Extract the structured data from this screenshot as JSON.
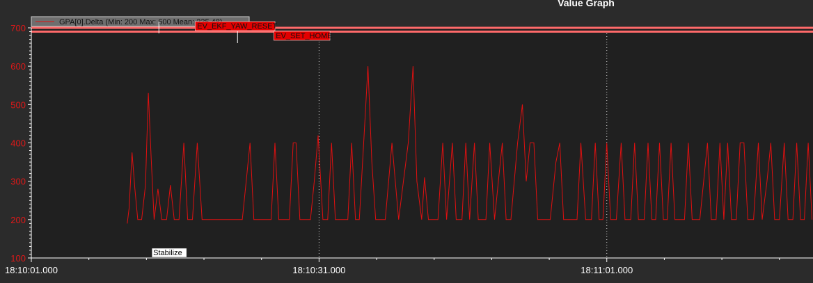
{
  "chart_data": {
    "type": "line",
    "title": "Value Graph",
    "ylim": [
      100,
      700
    ],
    "y_ticks": [
      "100",
      "200",
      "300",
      "400",
      "500",
      "600",
      "700"
    ],
    "x_ticks": [
      "18:10:01.000",
      "18:10:31.000",
      "18:11:01.000"
    ],
    "x_range_seconds": [
      0,
      81.5
    ],
    "x_grid": "vertical dotted at major x ticks",
    "legend_placement": "top-left",
    "series": [
      {
        "name": "GPA[0].Delta",
        "legend_label": "GPA[0].Delta  (Min: 200 Max: 600 Mean: 235.48)",
        "color": "#e01010",
        "points": [
          [
            10.0,
            190
          ],
          [
            10.2,
            230
          ],
          [
            10.5,
            375
          ],
          [
            10.8,
            280
          ],
          [
            11.1,
            200
          ],
          [
            11.5,
            200
          ],
          [
            11.9,
            290
          ],
          [
            12.2,
            530
          ],
          [
            12.5,
            360
          ],
          [
            12.8,
            200
          ],
          [
            13.2,
            280
          ],
          [
            13.6,
            200
          ],
          [
            14.1,
            200
          ],
          [
            14.5,
            290
          ],
          [
            14.9,
            200
          ],
          [
            15.4,
            200
          ],
          [
            15.9,
            400
          ],
          [
            16.3,
            200
          ],
          [
            16.8,
            200
          ],
          [
            17.3,
            400
          ],
          [
            17.8,
            200
          ],
          [
            18.3,
            200
          ],
          [
            19.2,
            200
          ],
          [
            20.1,
            200
          ],
          [
            21.0,
            200
          ],
          [
            22.0,
            200
          ],
          [
            22.4,
            300
          ],
          [
            22.8,
            400
          ],
          [
            23.2,
            200
          ],
          [
            24.2,
            200
          ],
          [
            25.0,
            200
          ],
          [
            25.4,
            400
          ],
          [
            25.8,
            200
          ],
          [
            26.9,
            200
          ],
          [
            27.3,
            400
          ],
          [
            27.6,
            400
          ],
          [
            28.0,
            200
          ],
          [
            29.1,
            200
          ],
          [
            29.5,
            300
          ],
          [
            29.9,
            420
          ],
          [
            30.4,
            200
          ],
          [
            30.9,
            200
          ],
          [
            31.3,
            400
          ],
          [
            31.7,
            200
          ],
          [
            33.0,
            200
          ],
          [
            33.4,
            400
          ],
          [
            33.8,
            200
          ],
          [
            34.2,
            200
          ],
          [
            34.7,
            420
          ],
          [
            35.1,
            600
          ],
          [
            35.5,
            350
          ],
          [
            35.9,
            200
          ],
          [
            36.9,
            200
          ],
          [
            37.6,
            400
          ],
          [
            38.3,
            200
          ],
          [
            39.3,
            400
          ],
          [
            39.8,
            600
          ],
          [
            40.2,
            300
          ],
          [
            40.7,
            200
          ],
          [
            41.0,
            310
          ],
          [
            41.4,
            200
          ],
          [
            42.4,
            200
          ],
          [
            42.9,
            400
          ],
          [
            43.3,
            200
          ],
          [
            43.9,
            400
          ],
          [
            44.3,
            200
          ],
          [
            44.9,
            200
          ],
          [
            45.3,
            400
          ],
          [
            45.7,
            200
          ],
          [
            46.2,
            400
          ],
          [
            46.6,
            200
          ],
          [
            47.4,
            200
          ],
          [
            47.8,
            400
          ],
          [
            48.3,
            200
          ],
          [
            48.7,
            300
          ],
          [
            49.1,
            400
          ],
          [
            49.5,
            200
          ],
          [
            50.0,
            200
          ],
          [
            50.7,
            400
          ],
          [
            51.2,
            500
          ],
          [
            51.6,
            300
          ],
          [
            52.0,
            400
          ],
          [
            52.4,
            400
          ],
          [
            52.8,
            200
          ],
          [
            53.1,
            200
          ],
          [
            54.1,
            200
          ],
          [
            54.7,
            350
          ],
          [
            55.1,
            400
          ],
          [
            55.5,
            200
          ],
          [
            56.9,
            200
          ],
          [
            57.3,
            400
          ],
          [
            57.8,
            200
          ],
          [
            58.4,
            200
          ],
          [
            58.8,
            400
          ],
          [
            59.2,
            200
          ],
          [
            59.6,
            200
          ],
          [
            60.0,
            400
          ],
          [
            60.4,
            200
          ],
          [
            61.0,
            200
          ],
          [
            61.5,
            400
          ],
          [
            61.9,
            200
          ],
          [
            62.5,
            200
          ],
          [
            62.9,
            400
          ],
          [
            63.3,
            200
          ],
          [
            63.9,
            200
          ],
          [
            64.3,
            400
          ],
          [
            64.7,
            200
          ],
          [
            65.1,
            200
          ],
          [
            65.5,
            400
          ],
          [
            65.9,
            200
          ],
          [
            66.3,
            200
          ],
          [
            66.7,
            400
          ],
          [
            67.1,
            200
          ],
          [
            68.1,
            200
          ],
          [
            68.5,
            400
          ],
          [
            68.9,
            200
          ],
          [
            69.7,
            200
          ],
          [
            70.1,
            300
          ],
          [
            70.5,
            400
          ],
          [
            70.9,
            200
          ],
          [
            71.4,
            200
          ],
          [
            71.8,
            400
          ],
          [
            72.2,
            200
          ],
          [
            72.6,
            400
          ],
          [
            73.0,
            200
          ],
          [
            73.5,
            200
          ],
          [
            73.9,
            400
          ],
          [
            74.3,
            400
          ],
          [
            74.7,
            200
          ],
          [
            75.3,
            200
          ],
          [
            75.8,
            400
          ],
          [
            76.2,
            200
          ],
          [
            76.7,
            300
          ],
          [
            77.1,
            400
          ],
          [
            77.5,
            200
          ],
          [
            78.0,
            200
          ],
          [
            78.5,
            400
          ],
          [
            78.9,
            200
          ],
          [
            79.4,
            200
          ],
          [
            79.8,
            400
          ],
          [
            80.2,
            200
          ],
          [
            80.6,
            200
          ],
          [
            81.0,
            400
          ],
          [
            81.4,
            200
          ]
        ]
      }
    ],
    "events": [
      {
        "label": "EV_EKF_YAW_RESET",
        "t": 13.3
      },
      {
        "label": "EV_SET_HOME",
        "t": 21.5
      }
    ],
    "modes": [
      {
        "label": "Stabilize",
        "t": 9.3
      }
    ],
    "reference_lines": [
      {
        "value": 700,
        "color": "#ff6a6a"
      },
      {
        "value": 690,
        "color": "#ff6a6a"
      }
    ]
  }
}
